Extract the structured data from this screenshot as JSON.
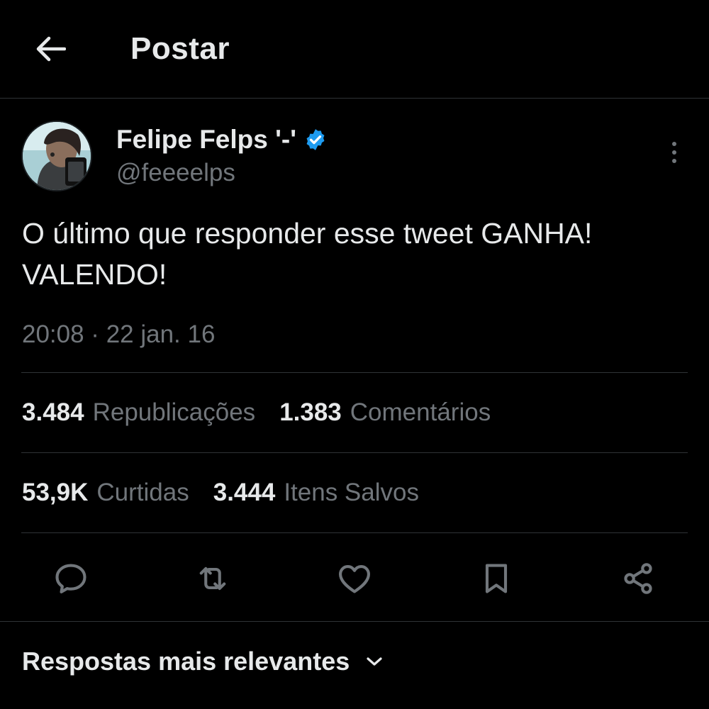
{
  "header": {
    "title": "Postar",
    "back_icon": "arrow-left-icon"
  },
  "author": {
    "display_name": "Felipe Felps '-'",
    "handle": "@feeeelps",
    "verified": true,
    "verified_color": "#1d9bf0"
  },
  "tweet": {
    "text": "O último que responder esse tweet GANHA!\nVALENDO!",
    "timestamp": "20:08 · 22 jan. 16"
  },
  "stats": {
    "row1": [
      {
        "value": "3.484",
        "label": "Republicações"
      },
      {
        "value": "1.383",
        "label": "Comentários"
      }
    ],
    "row2": [
      {
        "value": "53,9K",
        "label": "Curtidas"
      },
      {
        "value": "3.444",
        "label": "Itens Salvos"
      }
    ]
  },
  "actions": [
    {
      "icon": "reply-icon"
    },
    {
      "icon": "retweet-icon"
    },
    {
      "icon": "like-icon"
    },
    {
      "icon": "bookmark-icon"
    },
    {
      "icon": "share-icon"
    }
  ],
  "replies": {
    "sort_label": "Respostas mais relevantes",
    "sort_icon": "chevron-down-icon"
  },
  "colors": {
    "background": "#000000",
    "text_primary": "#e7e9ea",
    "text_secondary": "#71767b",
    "divider": "#2f3336",
    "accent": "#1d9bf0"
  }
}
